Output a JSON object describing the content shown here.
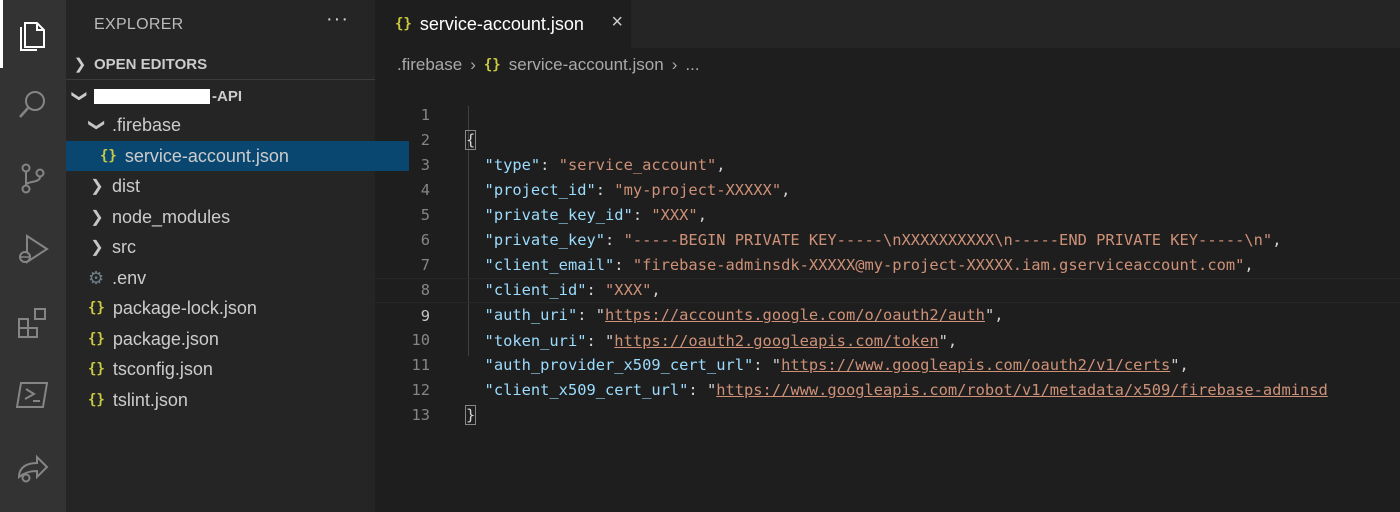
{
  "activity_bar": {
    "items": [
      {
        "icon": "files-icon",
        "active": true
      },
      {
        "icon": "search-icon",
        "active": false
      },
      {
        "icon": "source-control-icon",
        "active": false
      },
      {
        "icon": "run-debug-icon",
        "active": false
      },
      {
        "icon": "extensions-icon",
        "active": false
      },
      {
        "icon": "terminal-icon",
        "active": false
      },
      {
        "icon": "live-share-icon",
        "active": false
      }
    ]
  },
  "sidebar": {
    "title": "EXPLORER",
    "more": "···",
    "open_editors": "OPEN EDITORS",
    "project_suffix": "-API",
    "tree": [
      {
        "name": ".firebase",
        "type": "folder",
        "expanded": true
      },
      {
        "name": "service-account.json",
        "type": "json",
        "selected": true
      },
      {
        "name": "dist",
        "type": "folder",
        "expanded": false
      },
      {
        "name": "node_modules",
        "type": "folder",
        "expanded": false
      },
      {
        "name": "src",
        "type": "folder",
        "expanded": false
      },
      {
        "name": ".env",
        "type": "gear"
      },
      {
        "name": "package-lock.json",
        "type": "json"
      },
      {
        "name": "package.json",
        "type": "json"
      },
      {
        "name": "tsconfig.json",
        "type": "json"
      },
      {
        "name": "tslint.json",
        "type": "json"
      }
    ]
  },
  "editor": {
    "tab": {
      "icon_text": "{}",
      "label": "service-account.json",
      "close": "×"
    },
    "breadcrumb": {
      "folder": ".firebase",
      "icon_text": "{}",
      "file": "service-account.json",
      "more": "..."
    },
    "lines": [
      {
        "num": "1",
        "text": "{"
      },
      {
        "num": "2",
        "key": "\"type\"",
        "value": "\"service_account\"",
        "url": false,
        "trail": ","
      },
      {
        "num": "3",
        "key": "\"project_id\"",
        "value": "\"my-project-XXXXX\"",
        "url": false,
        "trail": ","
      },
      {
        "num": "4",
        "key": "\"private_key_id\"",
        "value": "\"XXX\"",
        "url": false,
        "trail": ","
      },
      {
        "num": "5",
        "key": "\"private_key\"",
        "value": "\"-----BEGIN PRIVATE KEY-----\\nXXXXXXXXXX\\n-----END PRIVATE KEY-----\\n\"",
        "url": false,
        "trail": ","
      },
      {
        "num": "6",
        "key": "\"client_email\"",
        "value": "\"firebase-adminsdk-XXXXX@my-project-XXXXX.iam.gserviceaccount.com\"",
        "url": false,
        "trail": ","
      },
      {
        "num": "7",
        "key": "\"client_id\"",
        "value": "\"XXX\"",
        "url": false,
        "trail": ","
      },
      {
        "num": "8",
        "key": "\"auth_uri\"",
        "value": "https://accounts.google.com/o/oauth2/auth",
        "url": true,
        "trail": ","
      },
      {
        "num": "9",
        "key": "\"token_uri\"",
        "value": "https://oauth2.googleapis.com/token",
        "url": true,
        "trail": ",",
        "current": true
      },
      {
        "num": "10",
        "key": "\"auth_provider_x509_cert_url\"",
        "value": "https://www.googleapis.com/oauth2/v1/certs",
        "url": true,
        "trail": ","
      },
      {
        "num": "11",
        "key": "\"client_x509_cert_url\"",
        "value": "https://www.googleapis.com/robot/v1/metadata/x509/firebase-adminsd",
        "url": true,
        "trail": ""
      },
      {
        "num": "12",
        "text": "}"
      },
      {
        "num": "13",
        "text": ""
      }
    ]
  },
  "colors": {
    "activity_bg": "#333333",
    "sidebar_bg": "#252526",
    "editor_bg": "#1e1e1e",
    "selection": "#094771",
    "json_key": "#9cdcfe",
    "json_string": "#ce9178",
    "json_icon": "#cbcb41"
  }
}
